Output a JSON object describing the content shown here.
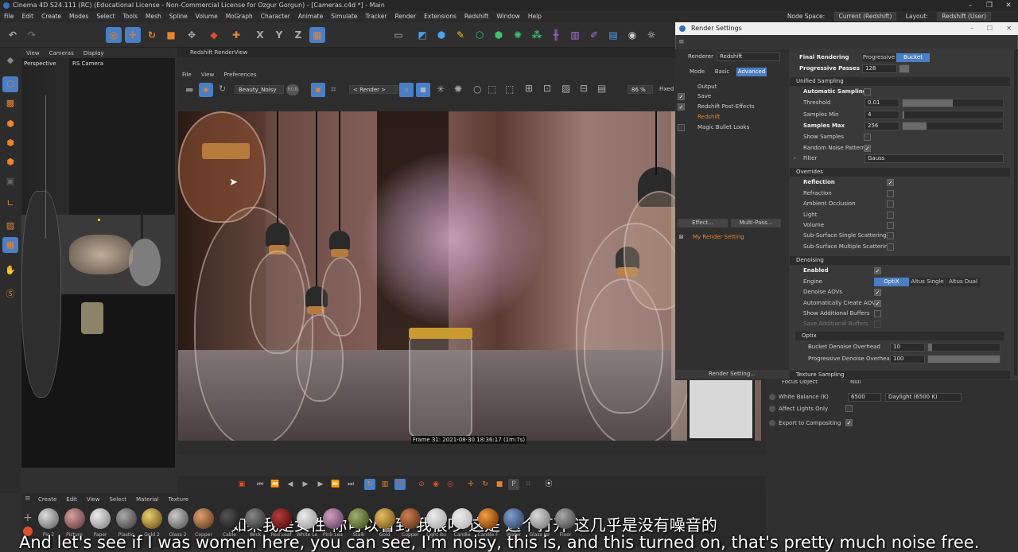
{
  "window": {
    "title": "Cinema 4D S24.111 (RC) (Educational License - Non-Commercial License for Ozgur Gorgun) - [Cameras.c4d *] - Main"
  },
  "menu": [
    "File",
    "Edit",
    "Create",
    "Modes",
    "Select",
    "Tools",
    "Mesh",
    "Spline",
    "Volume",
    "MoGraph",
    "Character",
    "Animate",
    "Simulate",
    "Tracker",
    "Render",
    "Extensions",
    "Redshift",
    "Window",
    "Help"
  ],
  "menu_right": {
    "node_space_label": "Node Space:",
    "node_space_value": "Current (Redshift)",
    "layout_label": "Layout:",
    "layout_value": "Redshift (User)"
  },
  "viewport": {
    "menu": [
      "View",
      "Cameras",
      "Display"
    ],
    "name": "Perspective",
    "camera": "RS Camera"
  },
  "renderview": {
    "title": "Redshift RenderView",
    "menu": [
      "File",
      "View",
      "Preferences"
    ],
    "aov": "Beauty_Noisy",
    "render_target": "< Render >",
    "zoom": "86 %",
    "fit": "Fixed",
    "frame_info": "Frame  31:  2021-08-30  18:36:17  (1m:7s)"
  },
  "material_bar": {
    "menu": [
      "Create",
      "Edit",
      "View",
      "Select",
      "Material",
      "Texture"
    ],
    "materials": [
      "Pic 2",
      "Picture",
      "Paper",
      "Plastic",
      "Gold 2",
      "Glass 2",
      "Copper",
      "Cable",
      "Wick",
      "Red Leaf",
      "White Le",
      "Pink Lea",
      "Stalk",
      "Gold",
      "Copper",
      "Light Bu",
      "Candle",
      "Candle F",
      "Water",
      "Glass Jar",
      "Floor"
    ]
  },
  "render_settings": {
    "title": "Render Settings",
    "renderer_label": "Renderer",
    "renderer_value": "Redshift",
    "mode_label": "Mode",
    "mode_basic": "Basic",
    "mode_advanced": "Advanced",
    "tree": [
      "Output",
      "Save",
      "Redshift Post-Effects",
      "Redshift",
      "Magic Bullet Looks"
    ],
    "effect_btn": "Effect...",
    "multipass_btn": "Multi-Pass...",
    "my_setting": "My Render Setting",
    "render_setting_btn": "Render Setting...",
    "final_rendering": "Final Rendering",
    "progressive": "Progressive",
    "bucket": "Bucket",
    "progressive_passes_label": "Progressive Passes",
    "progressive_passes": "128",
    "unified_sampling": "Unified Sampling",
    "automatic_sampling": "Automatic Sampling",
    "threshold_label": "Threshold",
    "threshold": "0.01",
    "samples_min_label": "Samples Min",
    "samples_min": "4",
    "samples_max_label": "Samples Max",
    "samples_max": "256",
    "show_samples": "Show Samples",
    "random_noise": "Random Noise Pattern",
    "filter_label": "Filter",
    "filter_value": "Gauss",
    "overrides": "Overrides",
    "overrides_items": [
      "Reflection",
      "Refraction",
      "Ambient Occlusion",
      "Light",
      "Volume",
      "Sub-Surface Single Scattering",
      "Sub-Surface Multiple Scattering"
    ],
    "denoising": "Denoising",
    "enabled": "Enabled",
    "engine_label": "Engine",
    "engine_optix": "OptiX",
    "engine_altus_single": "Altus Single",
    "engine_altus_dual": "Altus Dual",
    "denoise_aovs": "Denoise AOVs",
    "auto_create_aovs": "Automatically Create AOVs",
    "show_additional": "Show Additional Buffers",
    "save_additional": "Save Additional Buffers",
    "optix": "Optix",
    "bucket_overhead_label": "Bucket Denoise Overhead",
    "bucket_overhead": "10",
    "progressive_overhead_label": "Progressive Denoise Overhead",
    "progressive_overhead": "100",
    "texture_sampling": "Texture Sampling"
  },
  "attributes": {
    "focus_object_label": "Focus Object",
    "focus_object": "Null",
    "white_balance_label": "White Balance (K)",
    "white_balance": "6500",
    "white_balance_preset": "Daylight (6500 K)",
    "affect_lights": "Affect Lights Only",
    "export_compositing": "Export to Compositing"
  },
  "subtitles": {
    "cn": "如果我是女性 你可以看到 我很吵 这是 这个打开 这几乎是没有噪音的",
    "en": "And let's see if I was women here, you can see, I'm noisy, this is, and this turned on, that's pretty much noise free."
  },
  "colors": {
    "accent": "#4a7ec5",
    "orange": "#e8842c",
    "rs_red": "#e05030"
  }
}
